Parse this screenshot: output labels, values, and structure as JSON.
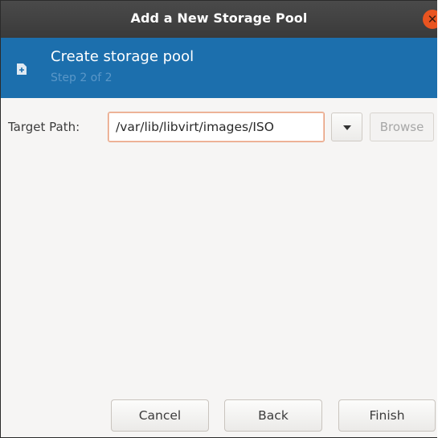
{
  "window": {
    "title": "Add a New Storage Pool",
    "close_glyph": "✕",
    "close_color": "#e95420"
  },
  "header": {
    "icon": "add-pool-icon",
    "title": "Create storage pool",
    "step": "Step 2 of 2",
    "background_color": "#1c6fad"
  },
  "form": {
    "target_path_label": "Target Path:",
    "target_path_value": "/var/lib/libvirt/images/ISO",
    "dropdown_icon": "chevron-down-icon",
    "browse_label": "Browse"
  },
  "buttons": {
    "cancel_label": "Cancel",
    "back_label": "Back",
    "finish_label": "Finish"
  }
}
